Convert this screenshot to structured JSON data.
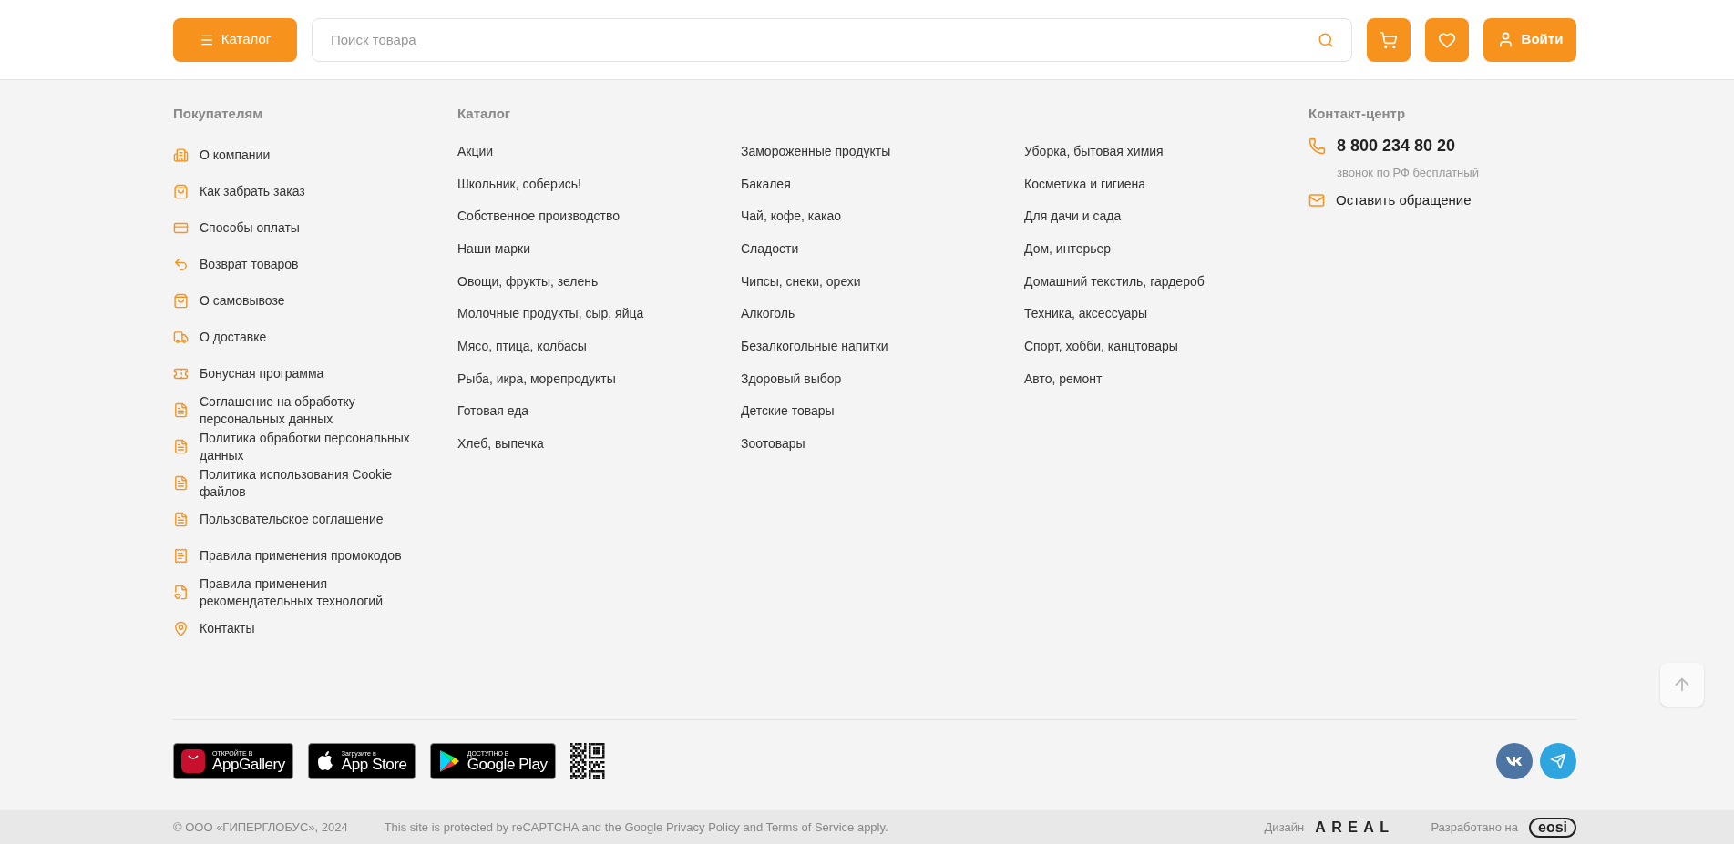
{
  "header": {
    "catalog_button": "Каталог",
    "search": {
      "placeholder": "Поиск товара"
    },
    "login_button": "Войти"
  },
  "buyers": {
    "title": "Покупателям",
    "items": [
      {
        "label": "О компании"
      },
      {
        "label": "Как забрать заказ"
      },
      {
        "label": "Способы оплаты"
      },
      {
        "label": "Возврат товаров"
      },
      {
        "label": "О самовывозе"
      },
      {
        "label": "О доставке"
      },
      {
        "label": "Бонусная программа"
      },
      {
        "label": "Соглашение на обработку персональных данных"
      },
      {
        "label": "Политика обработки персональных данных"
      },
      {
        "label": "Политика использования Cookie файлов"
      },
      {
        "label": "Пользовательское соглашение"
      },
      {
        "label": "Правила применения промокодов"
      },
      {
        "label": "Правила применения рекомендательных технологий"
      },
      {
        "label": "Контакты"
      }
    ]
  },
  "catalog": {
    "title": "Каталог",
    "columns": [
      [
        "Акции",
        "Школьник, соберись!",
        "Собственное производство",
        "Наши марки",
        "Овощи, фрукты, зелень",
        "Молочные продукты, сыр, яйца",
        "Мясо, птица, колбасы",
        "Рыба, икра, морепродукты",
        "Готовая еда",
        "Хлеб, выпечка"
      ],
      [
        "Замороженные продукты",
        "Бакалея",
        "Чай, кофе, какао",
        "Сладости",
        "Чипсы, снеки, орехи",
        "Алкоголь",
        "Безалкогольные напитки",
        "Здоровый выбор",
        "Детские товары",
        "Зоотовары"
      ],
      [
        "Уборка, бытовая химия",
        "Косметика и гигиена",
        "Для дачи и сада",
        "Дом, интерьер",
        "Домашний текстиль, гардероб",
        "Техника, аксессуары",
        "Спорт, хобби, канцтовары",
        "Авто, ремонт"
      ]
    ]
  },
  "contact": {
    "title": "Контакт-центр",
    "phone": "8 800 234 80 20",
    "phone_note": "звонок по РФ бесплатный",
    "appeal": "Оставить обращение"
  },
  "apps": [
    {
      "kind": "appgallery",
      "small": "ОТКРОЙТЕ В",
      "name": "AppGallery"
    },
    {
      "kind": "appstore",
      "small": "Загрузите в",
      "name": "App Store"
    },
    {
      "kind": "googleplay",
      "small": "ДОСТУПНО В",
      "name": "Google Play"
    }
  ],
  "bottom": {
    "copyright": "© ООО «ГИПЕРГЛОБУС», 2024",
    "recaptcha": "This site is protected by reCAPTCHA and the Google Privacy Policy and Terms of Service apply.",
    "design_label": "Дизайн",
    "design_logo": "AREAL",
    "dev_label": "Разработано на",
    "dev_logo": "eosi"
  }
}
